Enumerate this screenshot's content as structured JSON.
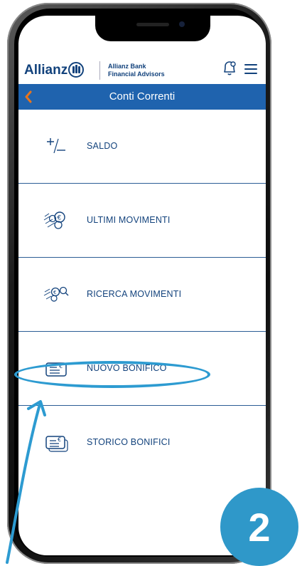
{
  "header": {
    "brand": "Allianz",
    "subtitle_line1": "Allianz Bank",
    "subtitle_line2": "Financial Advisors",
    "icons": [
      "allianz-logo-icon",
      "bell-icon",
      "hamburger-menu-icon"
    ]
  },
  "titlebar": {
    "title": "Conti Correnti",
    "back_icon": "chevron-left-icon"
  },
  "menu": {
    "items": [
      {
        "label": "SALDO",
        "icon": "plus-minus-icon"
      },
      {
        "label": "ULTIMI MOVIMENTI",
        "icon": "coins-euro-icon"
      },
      {
        "label": "RICERCA MOVIMENTI",
        "icon": "coins-search-icon"
      },
      {
        "label": "NUOVO BONIFICO",
        "icon": "transfer-card-icon"
      },
      {
        "label": "STORICO BONIFICI",
        "icon": "transfer-history-icon"
      }
    ]
  },
  "step_badge": "2",
  "colors": {
    "brand_blue": "#12427c",
    "titlebar_blue": "#1f63ae",
    "back_orange": "#e8741c",
    "highlight": "#2d9bd1",
    "badge": "#2f98c9"
  }
}
